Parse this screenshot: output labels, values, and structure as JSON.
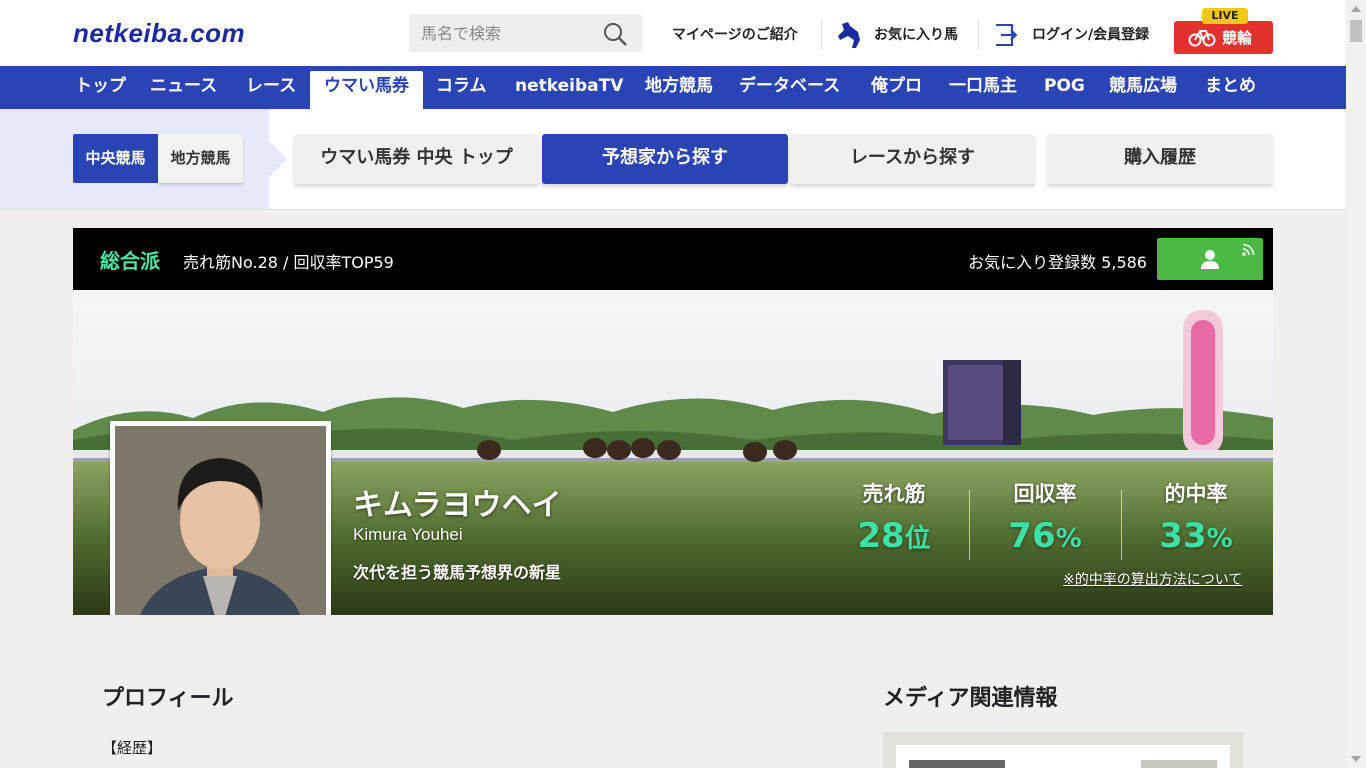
{
  "header": {
    "logo": "netkeiba.com",
    "search_placeholder": "馬名で検索",
    "links": {
      "mypage": "マイページのご紹介",
      "favorite_horse": "お気に入り馬",
      "login": "ログイン/会員登録"
    },
    "keirin": {
      "label": "競輪",
      "live": "LIVE"
    }
  },
  "gnav": {
    "items": [
      "トップ",
      "ニュース",
      "レース",
      "ウマい馬券",
      "コラム",
      "netkeibaTV",
      "地方競馬",
      "データベース",
      "俺プロ",
      "一口馬主",
      "POG",
      "競馬広場",
      "まとめ"
    ],
    "active": "ウマい馬券"
  },
  "subnav": {
    "regions": [
      "中央競馬",
      "地方競馬"
    ],
    "active_region": "中央競馬",
    "tabs": [
      "ウマい馬券 中央 トップ",
      "予想家から探す",
      "レースから探す",
      "購入履歴"
    ],
    "active_tab": "予想家から探す"
  },
  "infobar": {
    "type": "総合派",
    "rank_text": "売れ筋No.28 / 回収率TOP59",
    "fav_count_text": "お気に入り登録数 5,586"
  },
  "profile": {
    "name_jp": "キムラヨウヘイ",
    "name_en": "Kimura Youhei",
    "catchphrase": "次代を担う競馬予想界の新星",
    "stats": [
      {
        "label": "売れ筋",
        "value": "28",
        "unit": "位"
      },
      {
        "label": "回収率",
        "value": "76",
        "unit": "%"
      },
      {
        "label": "的中率",
        "value": "33",
        "unit": "%"
      }
    ],
    "calc_link": "※的中率の算出方法について"
  },
  "content": {
    "profile_title": "プロフィール",
    "career_label": "【経歴】",
    "media_title": "メディア関連情報"
  },
  "colors": {
    "brand_blue": "#2b44b5",
    "accent_green": "#3ee0a6",
    "keirin_red": "#e4312f",
    "fav_green": "#4cb944"
  }
}
